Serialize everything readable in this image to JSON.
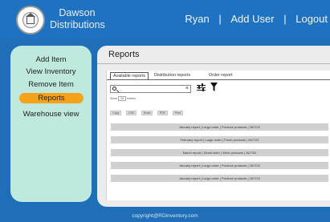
{
  "header": {
    "brand_line1": "Dawson",
    "brand_line2": "Distributions",
    "nav": {
      "user": "Ryan",
      "separator": "|",
      "add_user": "Add User",
      "logout": "Logout"
    }
  },
  "sidebar": {
    "items": [
      {
        "label": "Add Item",
        "active": false
      },
      {
        "label": "View Inventory",
        "active": false
      },
      {
        "label": "Remove Item",
        "active": false
      },
      {
        "label": "Reports",
        "active": true
      },
      {
        "label": "Warehouse view",
        "active": false
      }
    ]
  },
  "main": {
    "title": "Reports",
    "tabs": [
      {
        "label": "Available reports",
        "active": true
      },
      {
        "label": "Distribution reports",
        "active": false
      },
      {
        "label": "Order report",
        "active": false
      }
    ],
    "search": {
      "value": "",
      "clear_glyph": "×"
    },
    "show_entries": {
      "prefix": "Show",
      "value": "10",
      "suffix": "entries"
    },
    "export_buttons": [
      "Copy",
      "CSV",
      "Excel",
      "PDF",
      "Print"
    ],
    "reports": [
      "January report   |   Large order   |  Produce products |   26/7/22",
      "February report   |   Large order   |  Fresh products |   26/7/22",
      "March report | Small order | Wine products | 26/7/22",
      "January report   |   Large order   |  Produce products |   26/7/22",
      "January report   |   Large order   |  Produce products |   26/7/22"
    ]
  },
  "footer": {
    "text": "copyright@RDinventory.com"
  },
  "colors": {
    "header_bg": "#1f72bf",
    "sidebar_bg": "#bfe8de",
    "active_item": "#f4a21a",
    "panel_bg": "#ececec",
    "row_bg": "#d0d0d0"
  },
  "icons": [
    "logo-emblem",
    "search-icon",
    "clear-icon",
    "sliders-icon",
    "filter-icon"
  ]
}
